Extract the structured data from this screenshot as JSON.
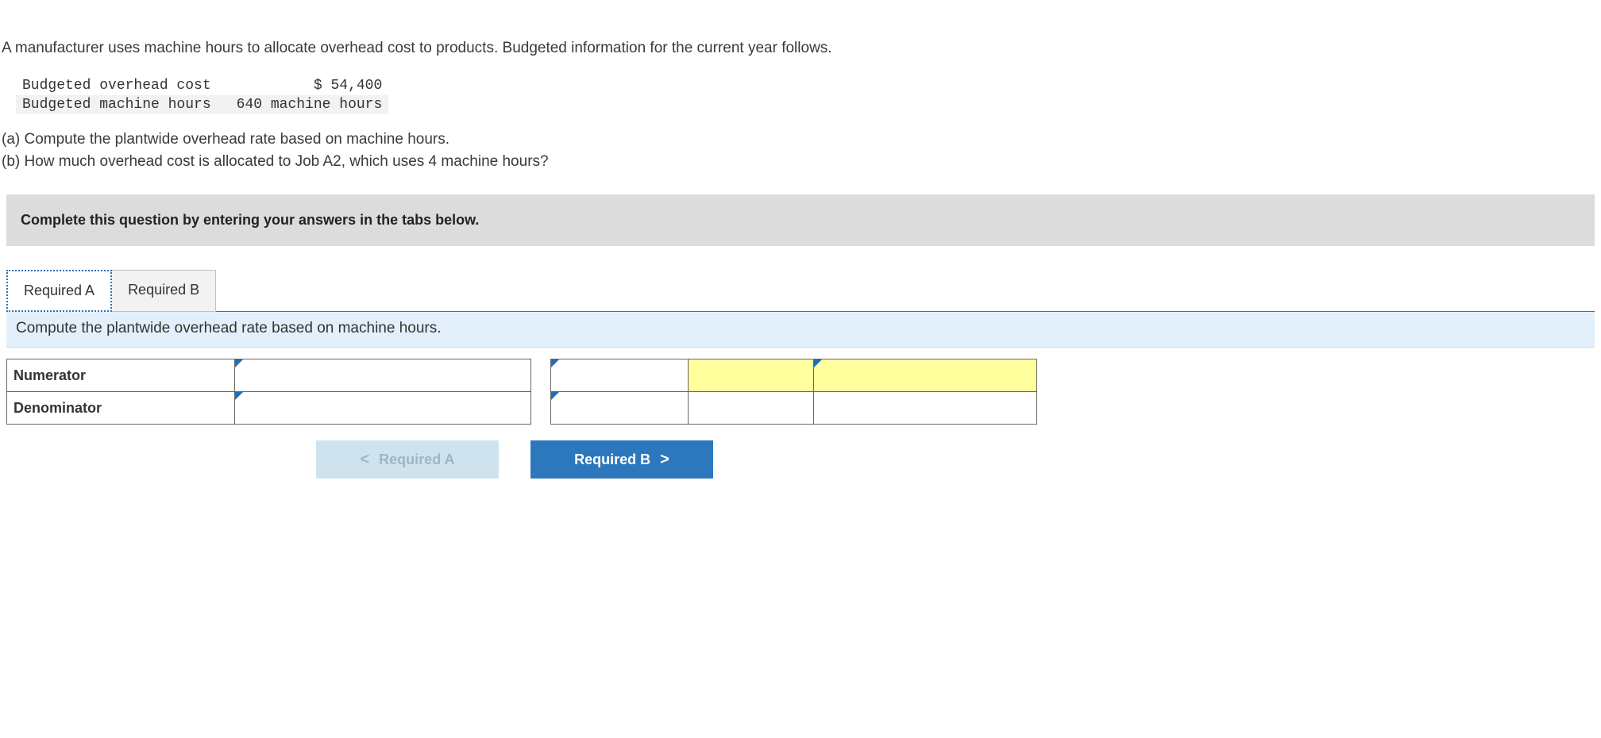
{
  "intro": "A manufacturer uses machine hours to allocate overhead cost to products. Budgeted information for the current year follows.",
  "given": {
    "row1_label": "Budgeted overhead cost",
    "row1_value": "$ 54,400",
    "row2_label": "Budgeted machine hours",
    "row2_value": "640 machine hours"
  },
  "q_a": "(a) Compute the plantwide overhead rate based on machine hours.",
  "q_b": "(b) How much overhead cost is allocated to Job A2, which uses 4 machine hours?",
  "instruction": "Complete this question by entering your answers in the tabs below.",
  "tabs": {
    "a": "Required A",
    "b": "Required B"
  },
  "sub_instruction": "Compute the plantwide overhead rate based on machine hours.",
  "table_labels": {
    "numerator": "Numerator",
    "denominator": "Denominator"
  },
  "nav": {
    "prev": "Required A",
    "next": "Required B"
  },
  "icons": {
    "chev_left": "<",
    "chev_right": ">"
  }
}
